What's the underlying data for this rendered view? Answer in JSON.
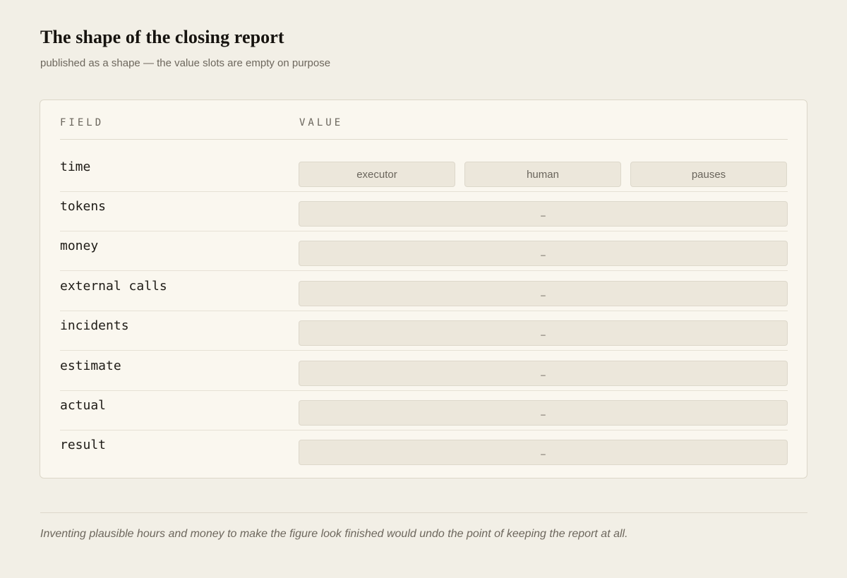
{
  "header": {
    "title": "The shape of the closing report",
    "subtitle": "published as a shape — the value slots are empty on purpose"
  },
  "table": {
    "columns": {
      "field": "FIELD",
      "value": "VALUE"
    },
    "time_row": {
      "field": "time",
      "slots": [
        "executor",
        "human",
        "pauses"
      ]
    },
    "rows": [
      {
        "field": "tokens",
        "value": "–"
      },
      {
        "field": "money",
        "value": "–"
      },
      {
        "field": "external calls",
        "value": "–"
      },
      {
        "field": "incidents",
        "value": "–"
      },
      {
        "field": "estimate",
        "value": "–"
      },
      {
        "field": "actual",
        "value": "–"
      },
      {
        "field": "result",
        "value": "–"
      }
    ]
  },
  "footer": {
    "note": "Inventing plausible hours and money to make the figure look finished would undo the point of keeping the report at all."
  }
}
